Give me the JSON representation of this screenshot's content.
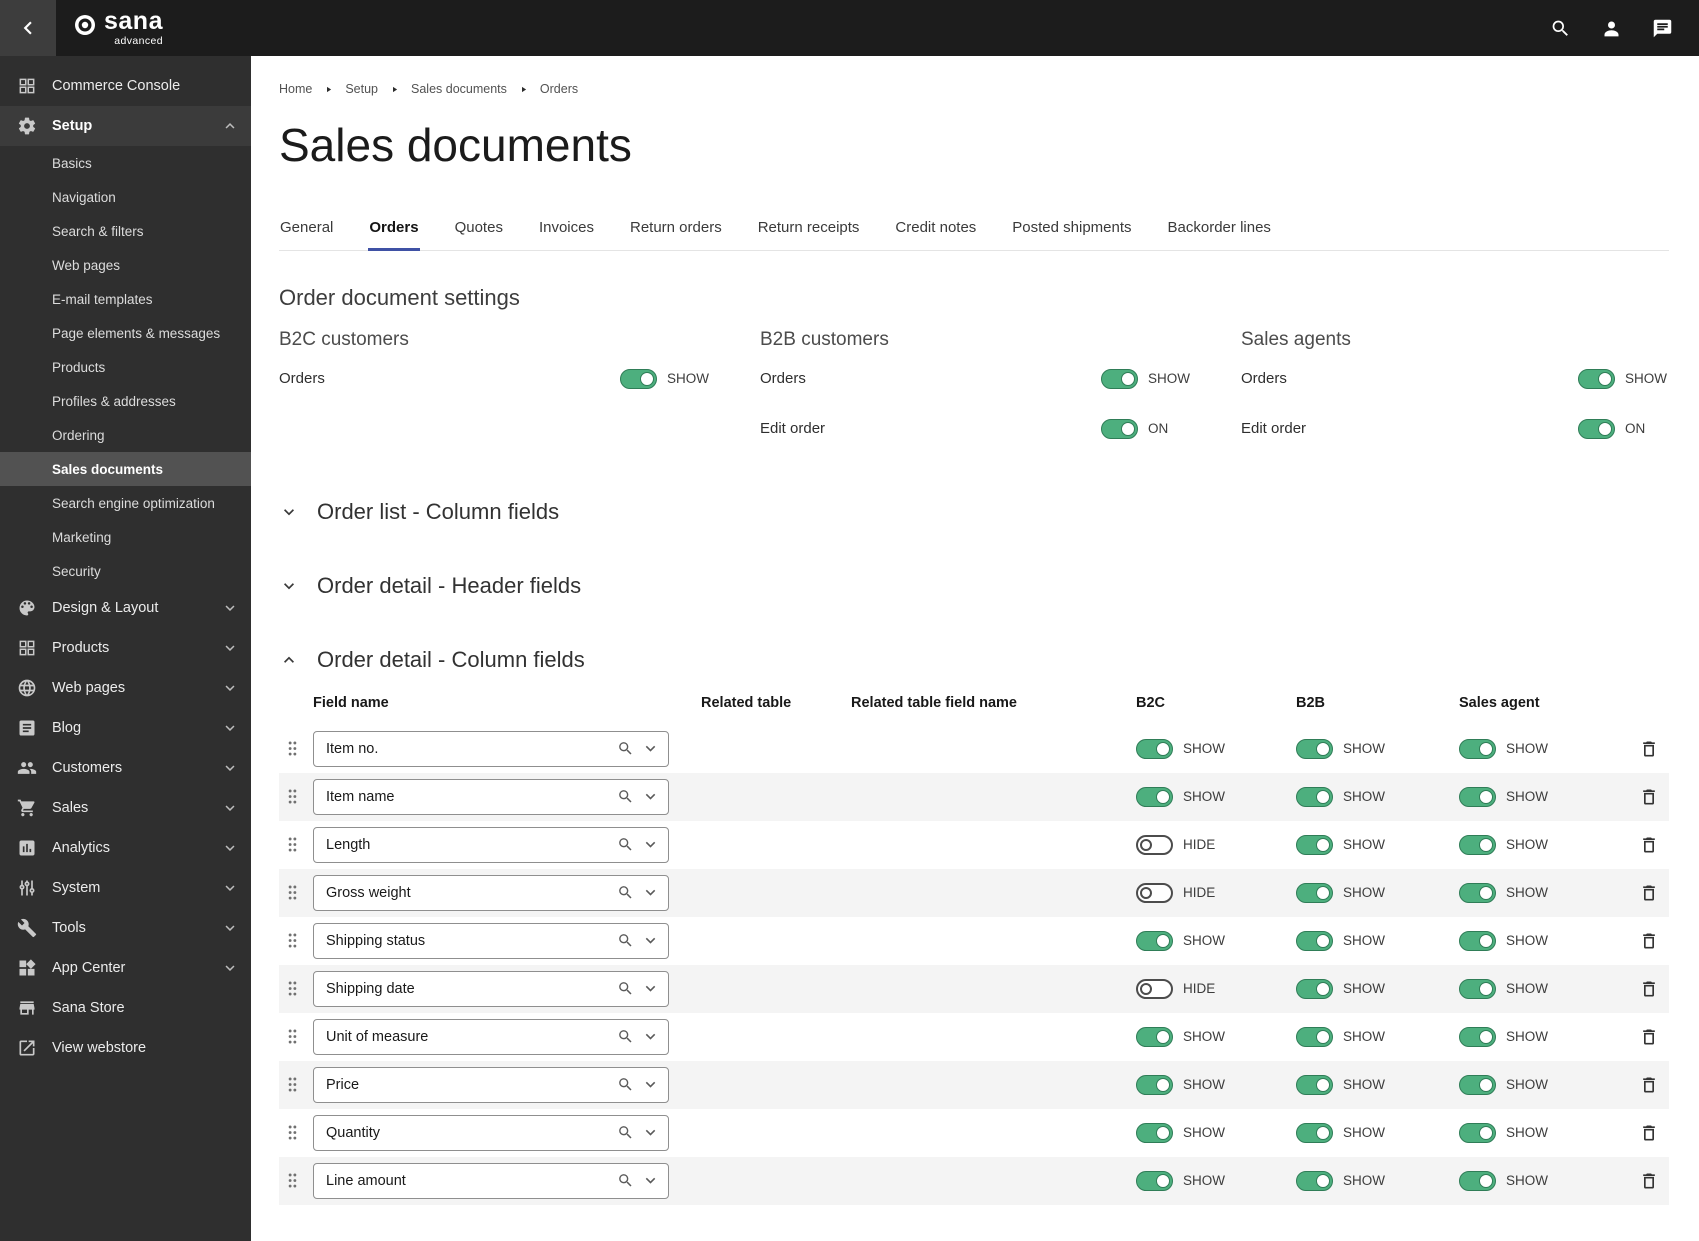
{
  "topbar": {
    "logo": "sana",
    "logo_sub": "advanced"
  },
  "breadcrumb": [
    "Home",
    "Setup",
    "Sales documents",
    "Orders"
  ],
  "page_title": "Sales documents",
  "tabs": {
    "items": [
      "General",
      "Orders",
      "Quotes",
      "Invoices",
      "Return orders",
      "Return receipts",
      "Credit notes",
      "Posted shipments",
      "Backorder lines"
    ],
    "active": "Orders"
  },
  "sidebar": {
    "items": [
      {
        "label": "Commerce Console",
        "icon": "grid"
      },
      {
        "label": "Setup",
        "icon": "gear",
        "active": true,
        "chevron": "up"
      },
      {
        "label": "Basics",
        "sub": true
      },
      {
        "label": "Navigation",
        "sub": true
      },
      {
        "label": "Search & filters",
        "sub": true
      },
      {
        "label": "Web pages",
        "sub": true
      },
      {
        "label": "E-mail templates",
        "sub": true
      },
      {
        "label": "Page elements & messages",
        "sub": true
      },
      {
        "label": "Products",
        "sub": true
      },
      {
        "label": "Profiles & addresses",
        "sub": true
      },
      {
        "label": "Ordering",
        "sub": true
      },
      {
        "label": "Sales documents",
        "sub": true,
        "selected": true
      },
      {
        "label": "Search engine optimization",
        "sub": true
      },
      {
        "label": "Marketing",
        "sub": true
      },
      {
        "label": "Security",
        "sub": true
      },
      {
        "label": "Design & Layout",
        "icon": "palette",
        "chevron": "down"
      },
      {
        "label": "Products",
        "icon": "products",
        "chevron": "down"
      },
      {
        "label": "Web pages",
        "icon": "globe",
        "chevron": "down"
      },
      {
        "label": "Blog",
        "icon": "blog",
        "chevron": "down"
      },
      {
        "label": "Customers",
        "icon": "people",
        "chevron": "down"
      },
      {
        "label": "Sales",
        "icon": "cart",
        "chevron": "down"
      },
      {
        "label": "Analytics",
        "icon": "chart",
        "chevron": "down"
      },
      {
        "label": "System",
        "icon": "sliders",
        "chevron": "down"
      },
      {
        "label": "Tools",
        "icon": "wrench",
        "chevron": "down"
      },
      {
        "label": "App Center",
        "icon": "apps",
        "chevron": "down"
      },
      {
        "label": "Sana Store",
        "icon": "store"
      },
      {
        "label": "View webstore",
        "icon": "external-link"
      }
    ]
  },
  "settings": {
    "title": "Order document settings",
    "groups": [
      {
        "title": "B2C customers",
        "rows": [
          {
            "label": "Orders",
            "on": true,
            "state": "SHOW"
          }
        ]
      },
      {
        "title": "B2B customers",
        "rows": [
          {
            "label": "Orders",
            "on": true,
            "state": "SHOW"
          },
          {
            "label": "Edit order",
            "on": true,
            "state": "ON"
          }
        ]
      },
      {
        "title": "Sales agents",
        "rows": [
          {
            "label": "Orders",
            "on": true,
            "state": "SHOW"
          },
          {
            "label": "Edit order",
            "on": true,
            "state": "ON"
          }
        ]
      }
    ]
  },
  "sections": [
    {
      "title": "Order list - Column fields",
      "expanded": false
    },
    {
      "title": "Order detail - Header fields",
      "expanded": false
    },
    {
      "title": "Order detail - Column fields",
      "expanded": true
    }
  ],
  "table": {
    "headers": {
      "field": "Field name",
      "related_table": "Related table",
      "related_field": "Related table field name",
      "b2c": "B2C",
      "b2b": "B2B",
      "agent": "Sales agent"
    },
    "rows": [
      {
        "field": "Item no.",
        "b2c": {
          "on": true,
          "state": "SHOW"
        },
        "b2b": {
          "on": true,
          "state": "SHOW"
        },
        "agent": {
          "on": true,
          "state": "SHOW"
        }
      },
      {
        "field": "Item name",
        "b2c": {
          "on": true,
          "state": "SHOW"
        },
        "b2b": {
          "on": true,
          "state": "SHOW"
        },
        "agent": {
          "on": true,
          "state": "SHOW"
        }
      },
      {
        "field": "Length",
        "b2c": {
          "on": false,
          "state": "HIDE"
        },
        "b2b": {
          "on": true,
          "state": "SHOW"
        },
        "agent": {
          "on": true,
          "state": "SHOW"
        }
      },
      {
        "field": "Gross weight",
        "b2c": {
          "on": false,
          "state": "HIDE"
        },
        "b2b": {
          "on": true,
          "state": "SHOW"
        },
        "agent": {
          "on": true,
          "state": "SHOW"
        }
      },
      {
        "field": "Shipping status",
        "b2c": {
          "on": true,
          "state": "SHOW"
        },
        "b2b": {
          "on": true,
          "state": "SHOW"
        },
        "agent": {
          "on": true,
          "state": "SHOW"
        }
      },
      {
        "field": "Shipping date",
        "b2c": {
          "on": false,
          "state": "HIDE"
        },
        "b2b": {
          "on": true,
          "state": "SHOW"
        },
        "agent": {
          "on": true,
          "state": "SHOW"
        }
      },
      {
        "field": "Unit of measure",
        "b2c": {
          "on": true,
          "state": "SHOW"
        },
        "b2b": {
          "on": true,
          "state": "SHOW"
        },
        "agent": {
          "on": true,
          "state": "SHOW"
        }
      },
      {
        "field": "Price",
        "b2c": {
          "on": true,
          "state": "SHOW"
        },
        "b2b": {
          "on": true,
          "state": "SHOW"
        },
        "agent": {
          "on": true,
          "state": "SHOW"
        }
      },
      {
        "field": "Quantity",
        "b2c": {
          "on": true,
          "state": "SHOW"
        },
        "b2b": {
          "on": true,
          "state": "SHOW"
        },
        "agent": {
          "on": true,
          "state": "SHOW"
        }
      },
      {
        "field": "Line amount",
        "b2c": {
          "on": true,
          "state": "SHOW"
        },
        "b2b": {
          "on": true,
          "state": "SHOW"
        },
        "agent": {
          "on": true,
          "state": "SHOW"
        }
      }
    ]
  },
  "colors": {
    "accent": "#3f51a5",
    "toggle_on": "#4daf7e",
    "topbar_bg": "#1c1c1c",
    "sidebar_bg": "#2f2f2f",
    "row_alt_bg": "#f4f4f4"
  }
}
